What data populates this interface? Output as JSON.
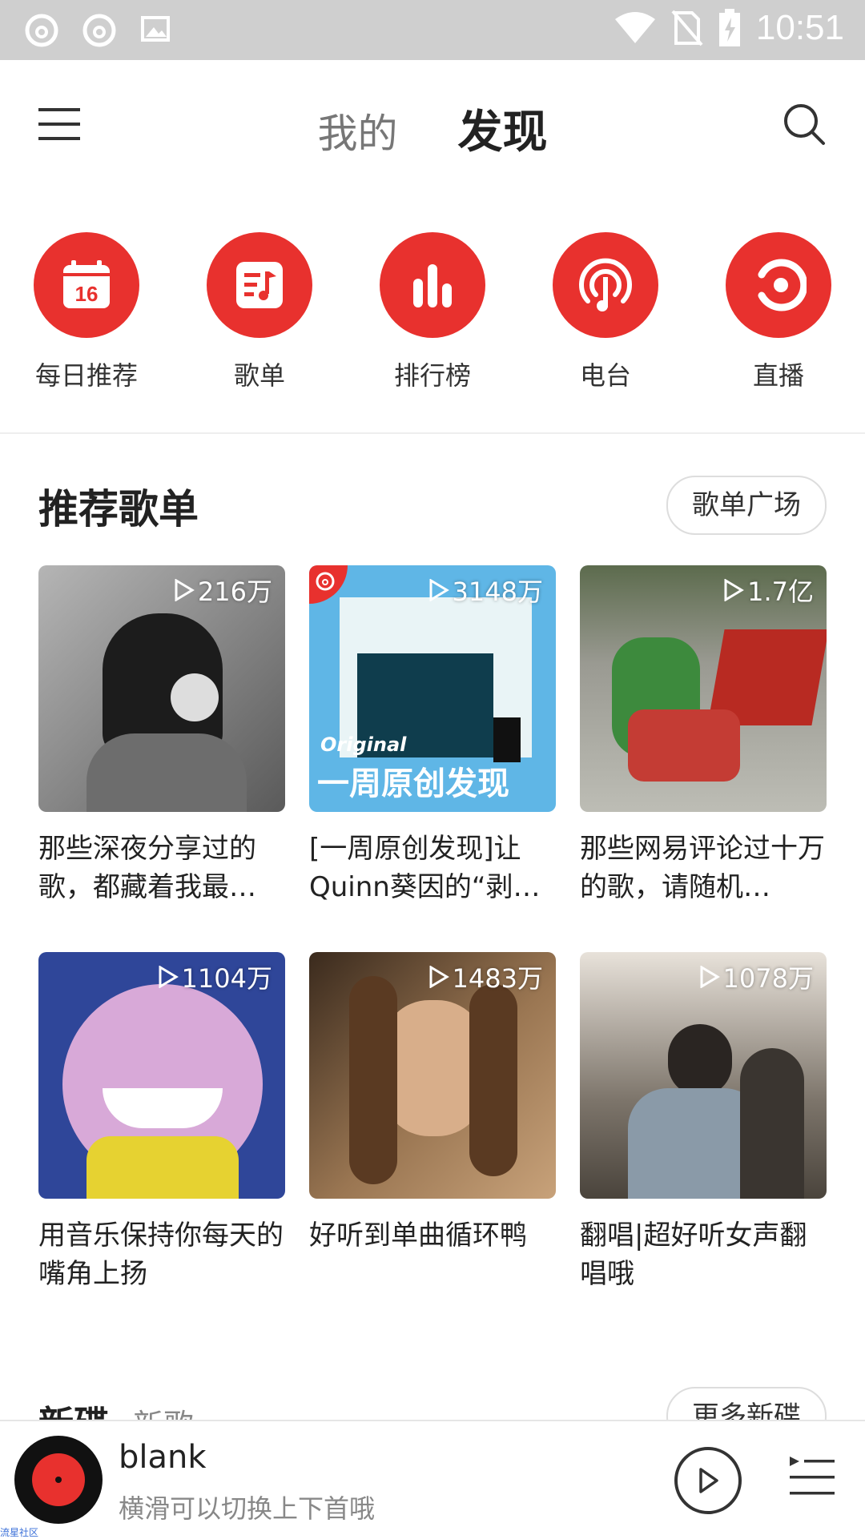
{
  "status_bar": {
    "time": "10:51",
    "icons": [
      "netease-icon",
      "netease-icon",
      "image-icon",
      "wifi-icon",
      "no-sim-icon",
      "battery-charging-icon"
    ]
  },
  "header": {
    "menu_icon": "menu-icon",
    "tabs": [
      {
        "label": "我的"
      },
      {
        "label": "发现"
      }
    ],
    "search_icon": "search-icon"
  },
  "shortcuts": [
    {
      "label": "每日推荐",
      "icon": "calendar-icon",
      "day": "16"
    },
    {
      "label": "歌单",
      "icon": "playlist-icon"
    },
    {
      "label": "排行榜",
      "icon": "chart-icon"
    },
    {
      "label": "电台",
      "icon": "radio-icon"
    },
    {
      "label": "直播",
      "icon": "live-icon"
    }
  ],
  "recommend": {
    "title": "推荐歌单",
    "more_label": "歌单广场",
    "playlists": [
      {
        "plays": "216万",
        "title": "那些深夜分享过的歌，都藏着我最…",
        "color": "#8a8a8a"
      },
      {
        "plays": "3148万",
        "title": "[一周原创发现]让Quinn葵因的“剥…",
        "color": "#5fb6e6",
        "overlay_1": "Original",
        "overlay_2": "一周原创发现"
      },
      {
        "plays": "1.7亿",
        "title": "那些网易评论过十万的歌，请随机…",
        "color": "#7a7a70"
      },
      {
        "plays": "1104万",
        "title": "用音乐保持你每天的嘴角上扬",
        "color": "#3c4fa0"
      },
      {
        "plays": "1483万",
        "title": "好听到单曲循环鸭",
        "color": "#8a6a4a"
      },
      {
        "plays": "1078万",
        "title": "翻唱|超好听女声翻唱哦",
        "color": "#6b6358"
      }
    ]
  },
  "new_section": {
    "title": "新碟",
    "sub": "新歌",
    "more_label": "更多新碟"
  },
  "player": {
    "song": "blank",
    "hint": "横滑可以切换上下首哦"
  },
  "watermark": "流星社区"
}
